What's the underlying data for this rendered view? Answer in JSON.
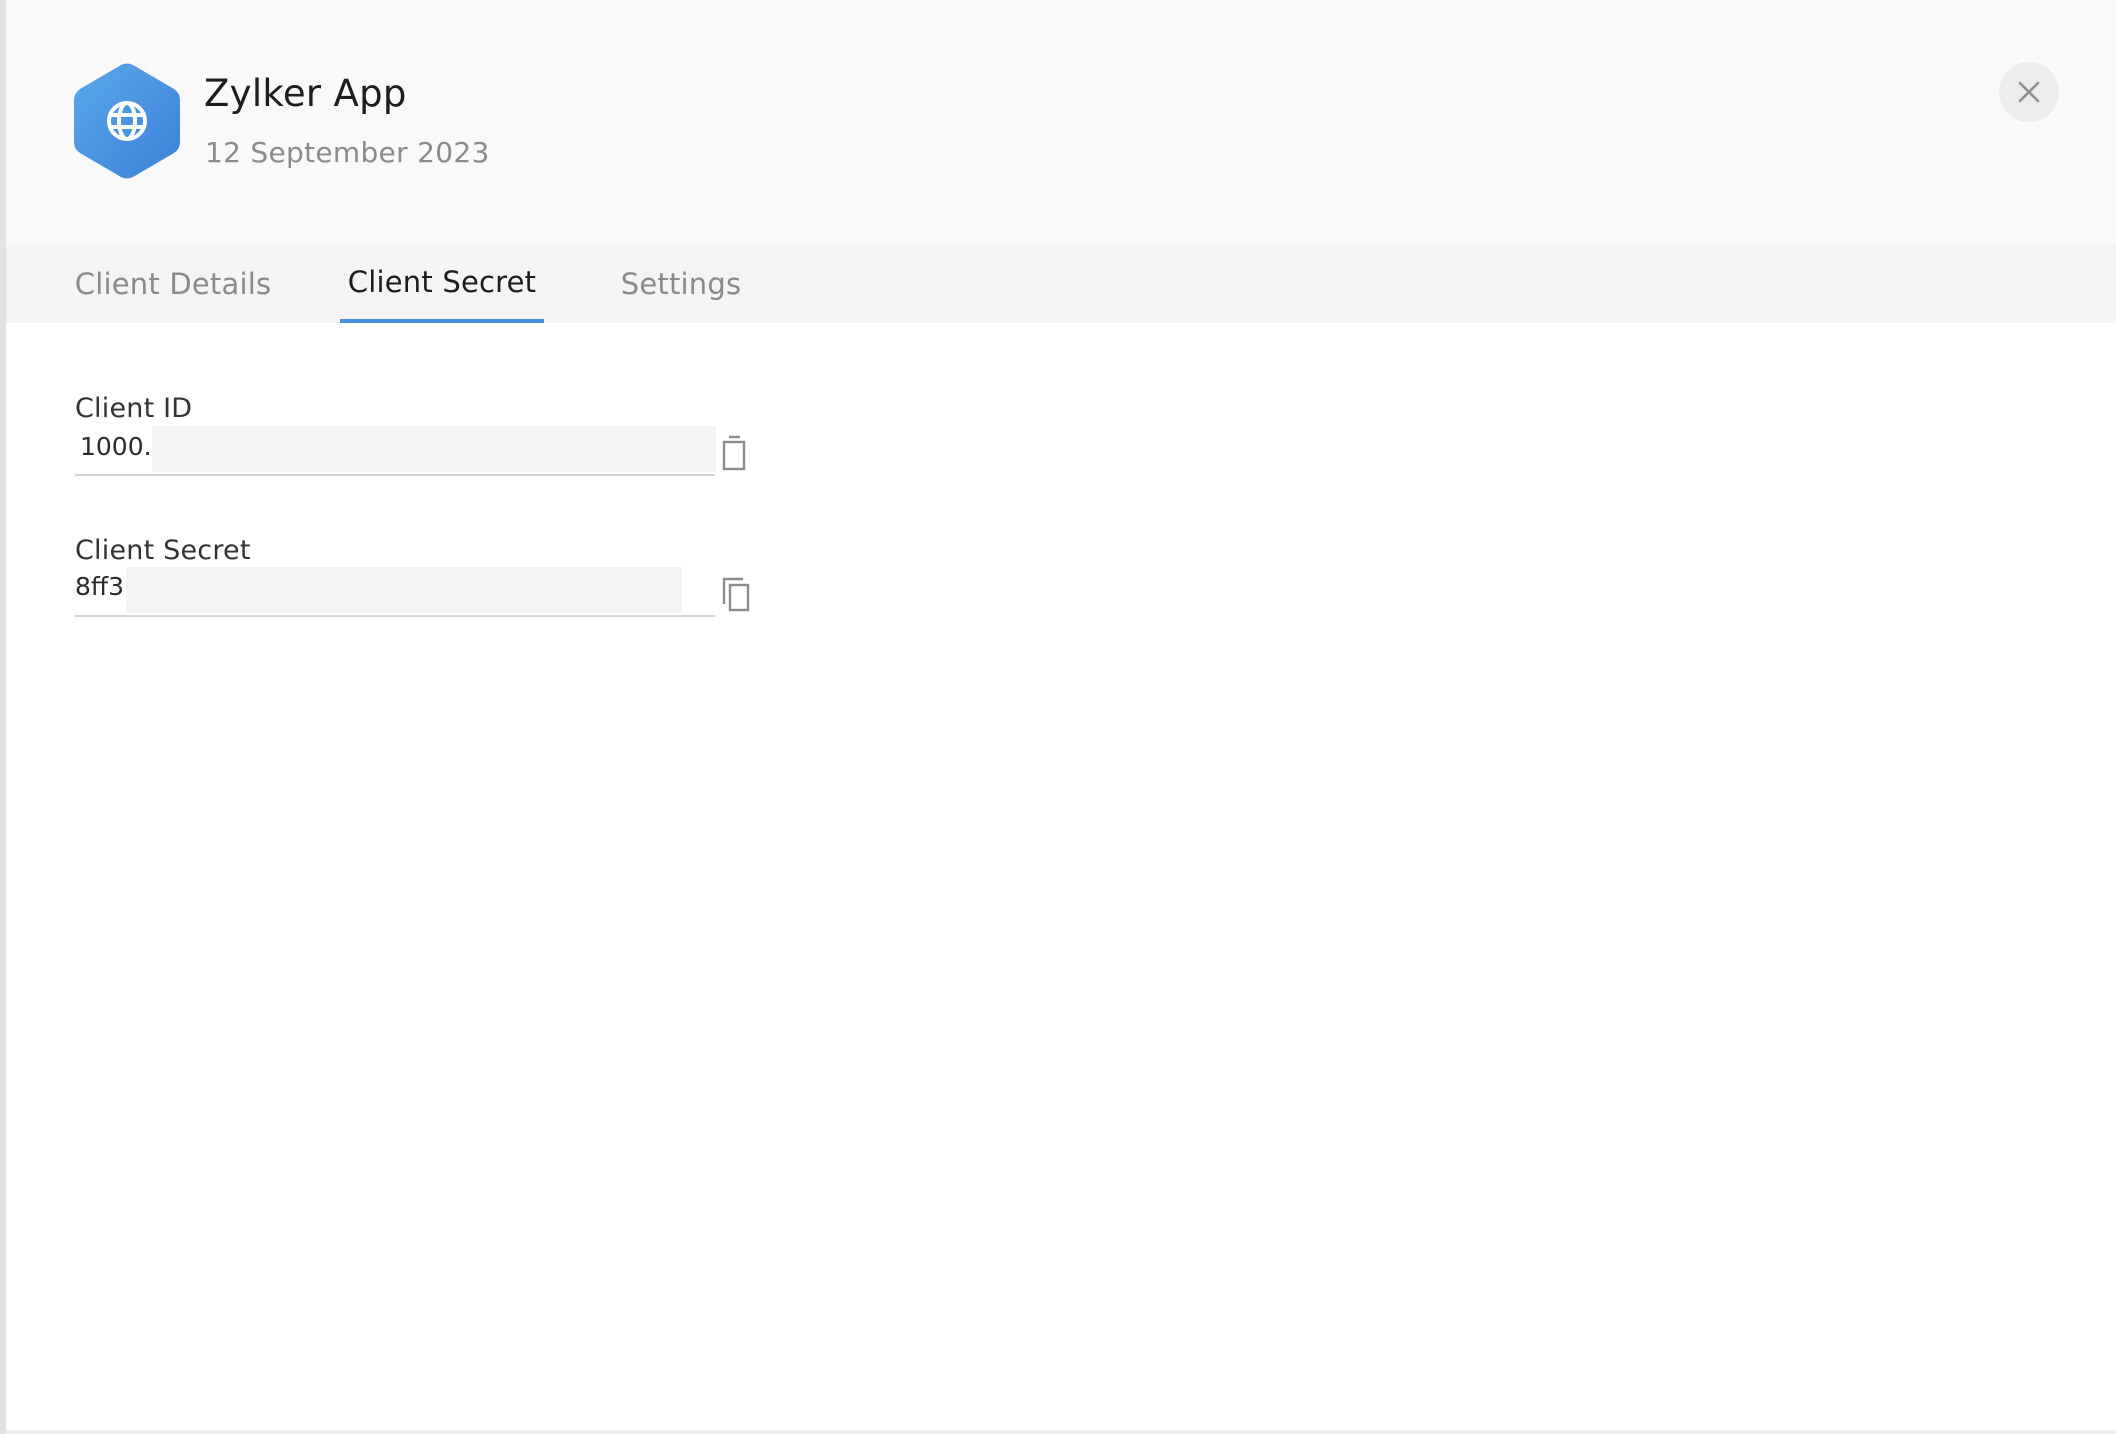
{
  "app": {
    "name": "Zylker App",
    "created_date": "12 September 2023",
    "logo_icon": "globe-icon",
    "brand_color": "#4a90e2"
  },
  "tabs": [
    {
      "label": "Client Details",
      "active": false
    },
    {
      "label": "Client Secret",
      "active": true
    },
    {
      "label": "Settings",
      "active": false
    }
  ],
  "fields": {
    "client_id": {
      "label": "Client ID",
      "value": "1000."
    },
    "client_secret": {
      "label": "Client Secret",
      "value": "8ff3"
    }
  },
  "icons": {
    "close": "close-icon",
    "copy": "copy-icon"
  },
  "colors": {
    "accent": "#4a8fdc",
    "header_bg": "#f9f9f9",
    "tabs_bg": "#f4f4f4"
  }
}
